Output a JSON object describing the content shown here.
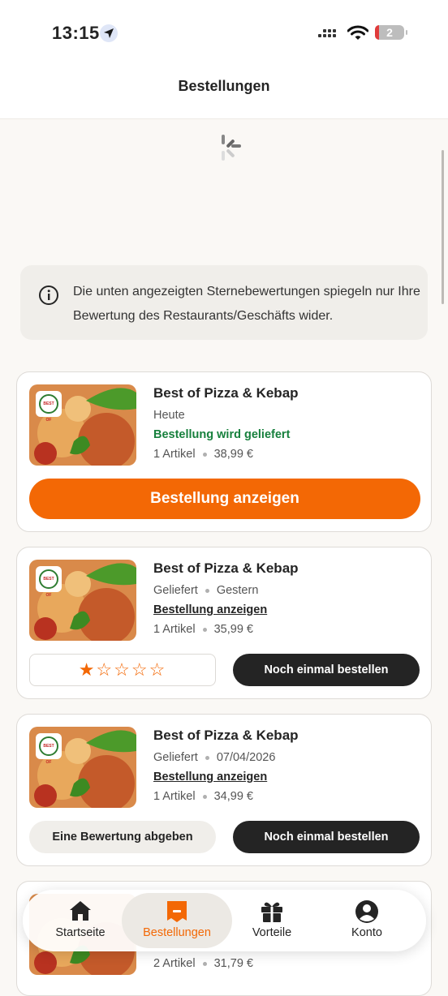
{
  "status": {
    "time": "13:15",
    "battery": "2"
  },
  "header": {
    "title": "Bestellungen"
  },
  "info": {
    "text": "Die unten angezeigten Sternebewertungen spiegeln nur Ihre Bewertung des Restaurants/Geschäfts wider."
  },
  "orders": [
    {
      "restaurant": "Best of Pizza & Kebap",
      "date": "Heute",
      "status": "Bestellung wird geliefert",
      "items": "1 Artikel",
      "price": "38,99 €",
      "button": "Bestellung anzeigen"
    },
    {
      "restaurant": "Best of Pizza & Kebap",
      "state": "Geliefert",
      "date": "Gestern",
      "link": "Bestellung anzeigen",
      "items": "1 Artikel",
      "price": "35,99 €",
      "rating": 1,
      "stars": "★☆☆☆☆",
      "reorder": "Noch einmal bestellen"
    },
    {
      "restaurant": "Best of Pizza & Kebap",
      "state": "Geliefert",
      "date": "07/04/2026",
      "link": "Bestellung anzeigen",
      "items": "1 Artikel",
      "price": "34,99 €",
      "review": "Eine Bewertung abgeben",
      "reorder": "Noch einmal bestellen"
    },
    {
      "items": "2 Artikel",
      "price": "31,79 €"
    }
  ],
  "logo_text": "BEST OF",
  "tabs": [
    {
      "label": "Startseite",
      "icon": "home-icon"
    },
    {
      "label": "Bestellungen",
      "icon": "receipt-icon",
      "active": true
    },
    {
      "label": "Vorteile",
      "icon": "gift-icon"
    },
    {
      "label": "Konto",
      "icon": "account-icon"
    }
  ],
  "colors": {
    "accent": "#f36805",
    "dark": "#242424",
    "green": "#17803d"
  }
}
